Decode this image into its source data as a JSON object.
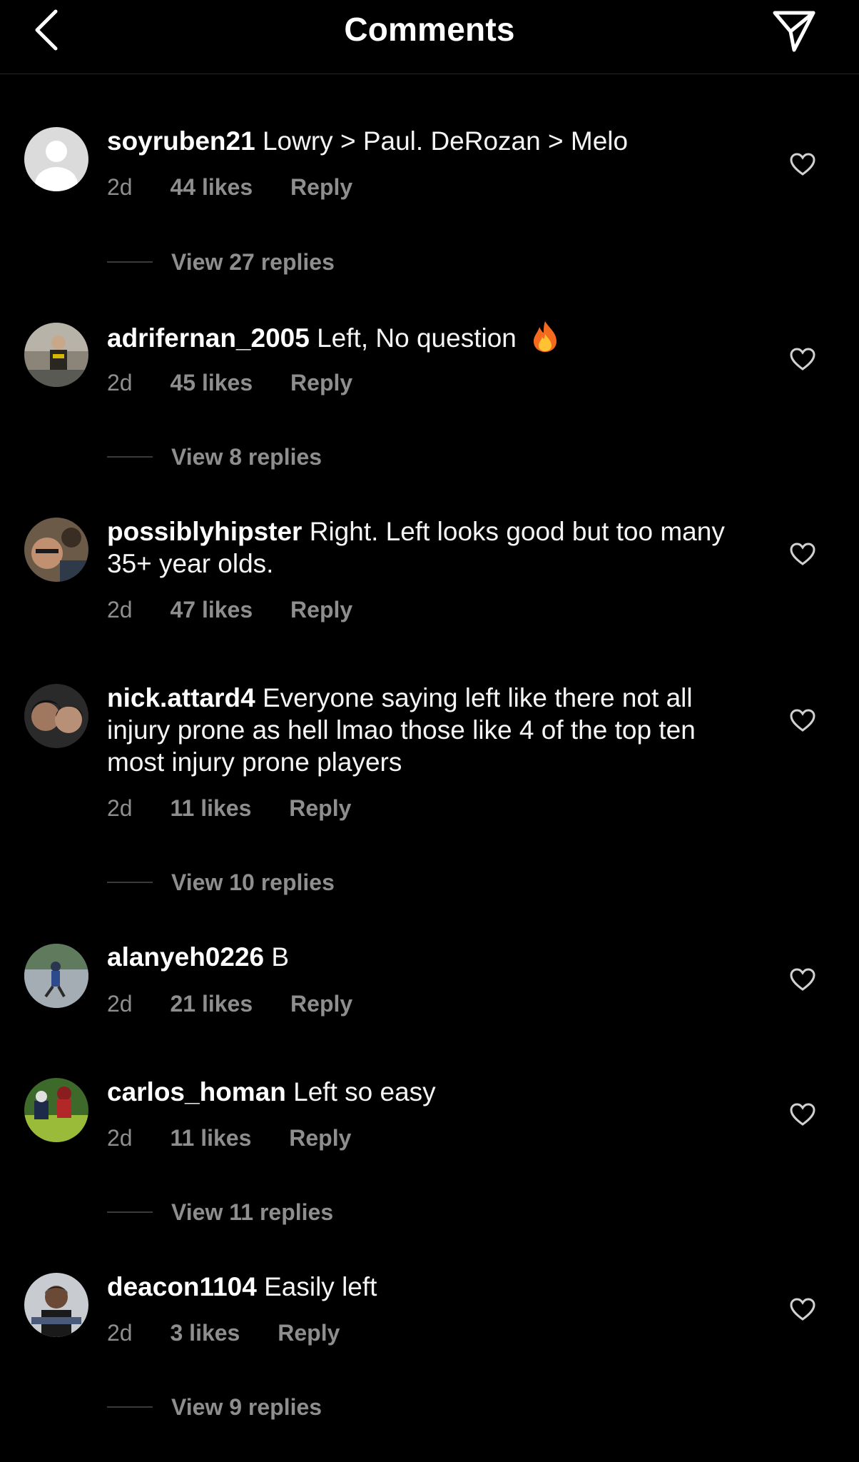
{
  "header": {
    "title": "Comments",
    "back_icon": "chevron-left-icon",
    "send_icon": "paper-plane-icon"
  },
  "colors": {
    "background": "#000000",
    "primary_text": "#ffffff",
    "secondary_text": "#8e8e8e",
    "divider": "#262626"
  },
  "comments": [
    {
      "username": "soyruben21",
      "text": "Lowry > Paul. DeRozan > Melo",
      "time": "2d",
      "likes": "44 likes",
      "reply_label": "Reply",
      "view_replies": "View 27 replies"
    },
    {
      "username": "adrifernan_2005",
      "text": "Left, No question",
      "emoji": "fire-emoji",
      "time": "2d",
      "likes": "45 likes",
      "reply_label": "Reply",
      "view_replies": "View 8 replies"
    },
    {
      "username": "possiblyhipster",
      "text": "Right. Left looks good but too many 35+ year olds.",
      "time": "2d",
      "likes": "47 likes",
      "reply_label": "Reply"
    },
    {
      "username": "nick.attard4",
      "text": "Everyone saying left like there not all injury prone as hell lmao those like 4 of the top ten most injury prone players",
      "time": "2d",
      "likes": "11 likes",
      "reply_label": "Reply",
      "view_replies": "View 10 replies"
    },
    {
      "username": "alanyeh0226",
      "text": "B",
      "time": "2d",
      "likes": "21 likes",
      "reply_label": "Reply"
    },
    {
      "username": "carlos_homan",
      "text": "Left so easy",
      "time": "2d",
      "likes": "11 likes",
      "reply_label": "Reply",
      "view_replies": "View 11 replies"
    },
    {
      "username": "deacon1104",
      "text": "Easily left",
      "time": "2d",
      "likes": "3 likes",
      "reply_label": "Reply",
      "view_replies": "View 9 replies"
    }
  ]
}
